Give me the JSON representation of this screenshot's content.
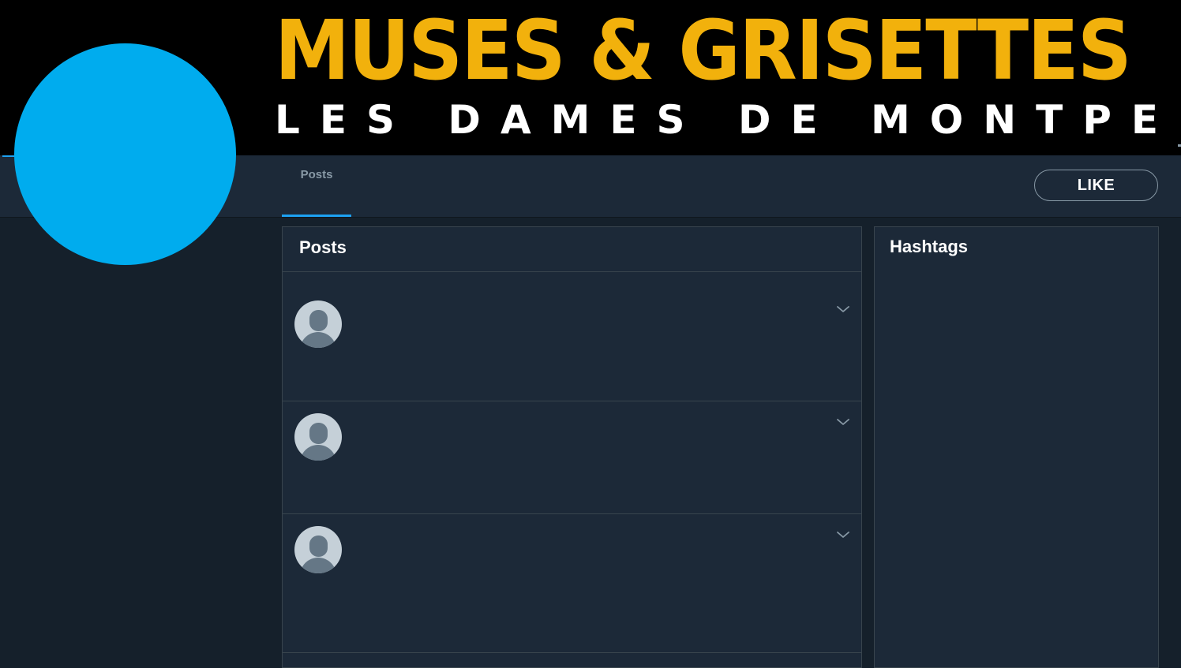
{
  "banner": {
    "title": "MUSES & GRISETTES",
    "subtitle": "LES DAMES DE MONTPELLIER"
  },
  "nav": {
    "tabs": [
      {
        "label": "Posts",
        "active": true
      }
    ],
    "like_label": "LIKE"
  },
  "posts": {
    "title": "Posts",
    "items": [
      {
        "author": "",
        "text": ""
      },
      {
        "author": "",
        "text": ""
      },
      {
        "author": "",
        "text": ""
      }
    ]
  },
  "hashtags": {
    "title": "Hashtags",
    "items": []
  },
  "colors": {
    "background": "#15202b",
    "panel": "#1c2938",
    "border": "#38444d",
    "accent": "#1da1f2",
    "profile_avatar": "#00acee",
    "banner_title": "#f2b10c",
    "banner_subtitle": "#ffffff"
  },
  "icons": {
    "post_menu": "chevron-down-icon",
    "post_avatar": "default-user-avatar-icon"
  }
}
